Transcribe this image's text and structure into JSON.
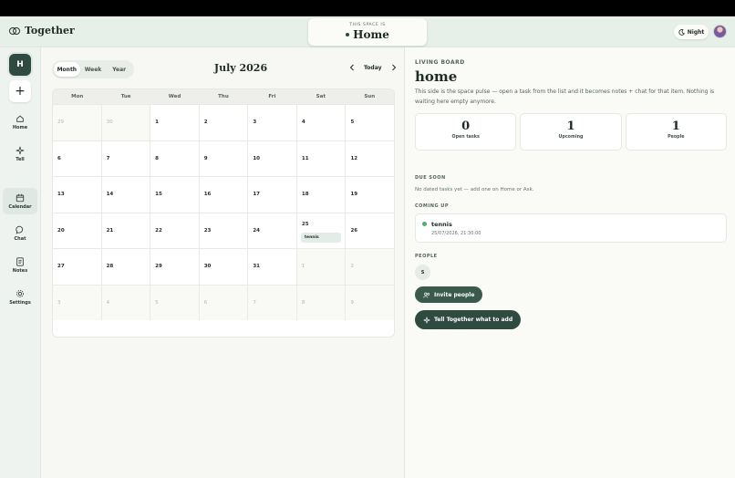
{
  "app": {
    "name": "Together"
  },
  "space": {
    "caption": "THIS SPACE IS",
    "name": "Home"
  },
  "header": {
    "night_label": "Night"
  },
  "sidebar": {
    "workspace_initial": "H",
    "add_label": "+",
    "items": [
      {
        "label": "Home",
        "icon": "home-icon"
      },
      {
        "label": "Tell",
        "icon": "sparkle-icon"
      },
      {
        "label": "Calendar",
        "icon": "calendar-icon",
        "active": true
      },
      {
        "label": "Chat",
        "icon": "chat-icon"
      },
      {
        "label": "Notes",
        "icon": "notes-icon"
      },
      {
        "label": "Settings",
        "icon": "gear-icon"
      }
    ]
  },
  "calendar": {
    "views": [
      "Month",
      "Week",
      "Year"
    ],
    "active_view": "Month",
    "month_label": "July 2026",
    "today_label": "Today",
    "weekdays": [
      "Mon",
      "Tue",
      "Wed",
      "Thu",
      "Fri",
      "Sat",
      "Sun"
    ],
    "weeks": [
      [
        {
          "d": "29",
          "out": true
        },
        {
          "d": "30",
          "out": true
        },
        {
          "d": "1"
        },
        {
          "d": "2"
        },
        {
          "d": "3"
        },
        {
          "d": "4"
        },
        {
          "d": "5"
        }
      ],
      [
        {
          "d": "6"
        },
        {
          "d": "7"
        },
        {
          "d": "8"
        },
        {
          "d": "9"
        },
        {
          "d": "10"
        },
        {
          "d": "11"
        },
        {
          "d": "12"
        }
      ],
      [
        {
          "d": "13"
        },
        {
          "d": "14"
        },
        {
          "d": "15"
        },
        {
          "d": "16"
        },
        {
          "d": "17"
        },
        {
          "d": "18"
        },
        {
          "d": "19"
        }
      ],
      [
        {
          "d": "20"
        },
        {
          "d": "21"
        },
        {
          "d": "22"
        },
        {
          "d": "23"
        },
        {
          "d": "24"
        },
        {
          "d": "25",
          "event": "tennis"
        },
        {
          "d": "26"
        }
      ],
      [
        {
          "d": "27"
        },
        {
          "d": "28"
        },
        {
          "d": "29"
        },
        {
          "d": "30"
        },
        {
          "d": "31"
        },
        {
          "d": "1",
          "out": true
        },
        {
          "d": "2",
          "out": true
        }
      ],
      [
        {
          "d": "3",
          "out": true
        },
        {
          "d": "4",
          "out": true
        },
        {
          "d": "5",
          "out": true
        },
        {
          "d": "6",
          "out": true
        },
        {
          "d": "7",
          "out": true
        },
        {
          "d": "8",
          "out": true
        },
        {
          "d": "9",
          "out": true
        }
      ]
    ]
  },
  "board": {
    "label": "LIVING BOARD",
    "title": "home",
    "description": "This side is the space pulse — open a task from the list and it becomes notes + chat for that item. Nothing is waiting here empty anymore.",
    "stats": [
      {
        "value": "0",
        "label": "Open tasks"
      },
      {
        "value": "1",
        "label": "Upcoming"
      },
      {
        "value": "1",
        "label": "People"
      }
    ],
    "due_soon_label": "DUE SOON",
    "due_soon_empty": "No dated tasks yet — add one on Home or Ask.",
    "coming_up_label": "COMING UP",
    "upcoming": {
      "title": "tennis",
      "datetime": "25/07/2026, 21:30:00"
    },
    "people_label": "PEOPLE",
    "person_initial": "S",
    "invite_label": "Invite people",
    "tell_label": "Tell Together what to add"
  }
}
